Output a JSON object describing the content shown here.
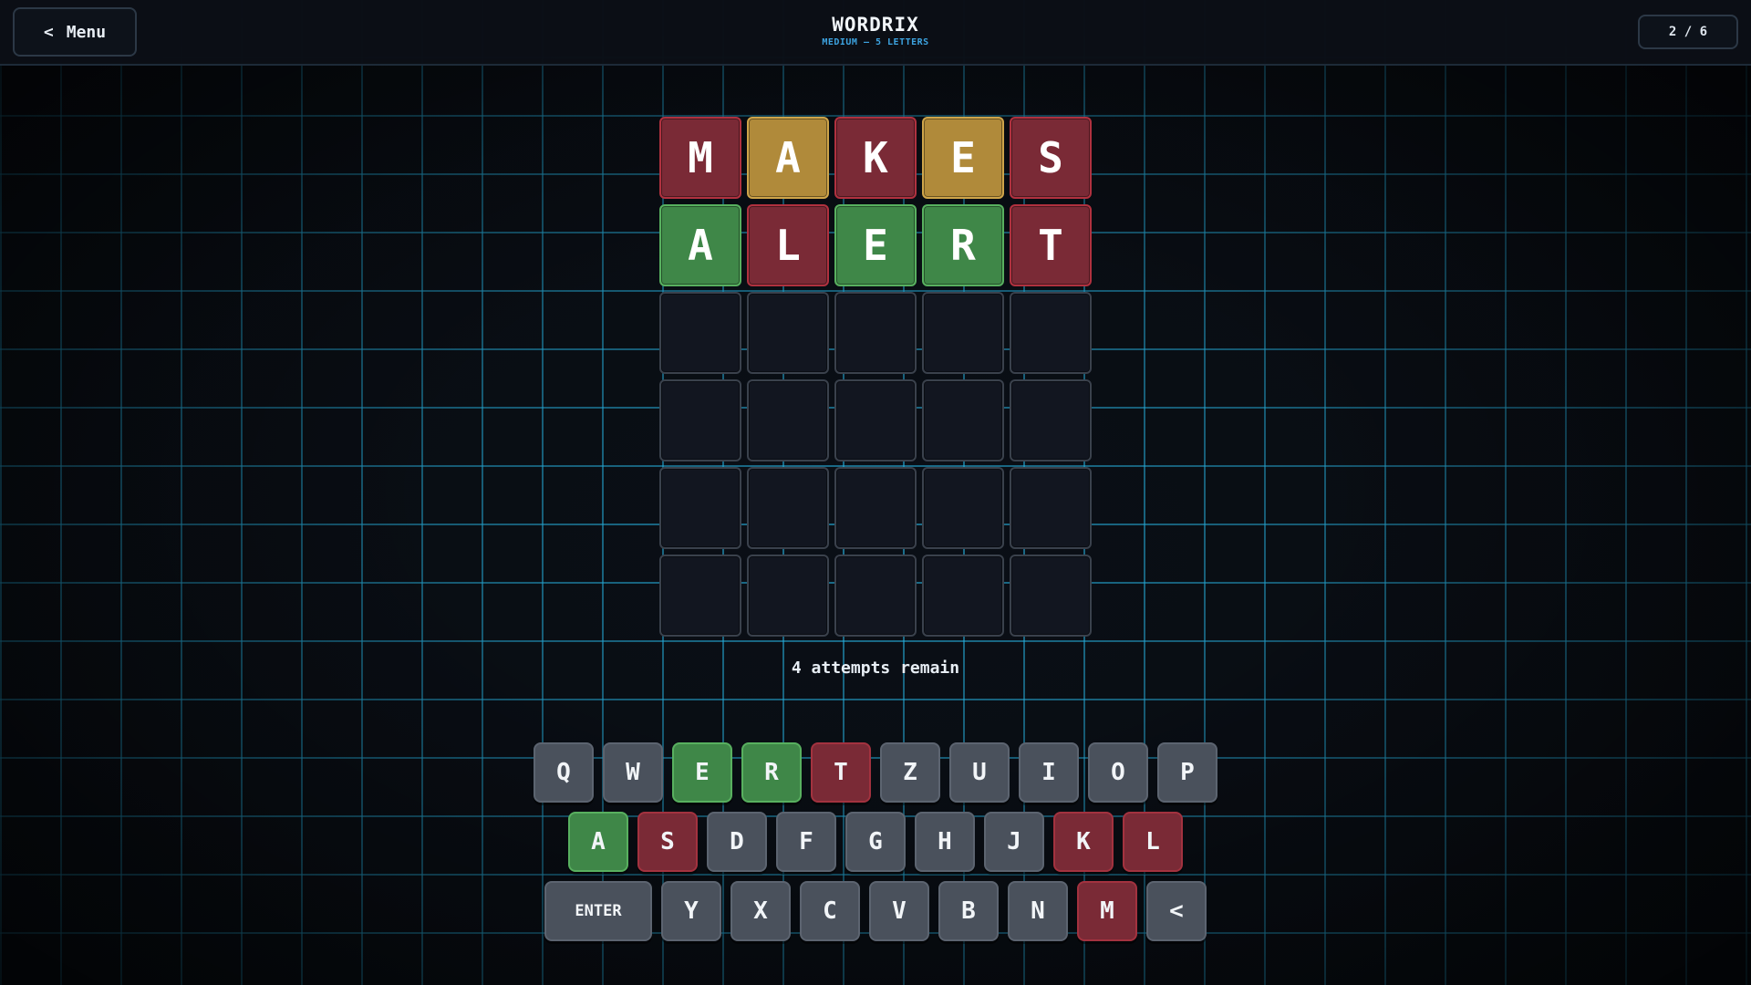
{
  "header": {
    "menu_chevron": "<",
    "menu_label": "Menu",
    "title": "WORDRIX",
    "subtitle": "MEDIUM – 5 LETTERS",
    "progress": "2 / 6"
  },
  "board": {
    "rows": [
      [
        {
          "letter": "M",
          "state": "absent"
        },
        {
          "letter": "A",
          "state": "present"
        },
        {
          "letter": "K",
          "state": "absent"
        },
        {
          "letter": "E",
          "state": "present"
        },
        {
          "letter": "S",
          "state": "absent"
        }
      ],
      [
        {
          "letter": "A",
          "state": "correct"
        },
        {
          "letter": "L",
          "state": "absent"
        },
        {
          "letter": "E",
          "state": "correct"
        },
        {
          "letter": "R",
          "state": "correct"
        },
        {
          "letter": "T",
          "state": "absent"
        }
      ],
      [
        {
          "letter": "",
          "state": "empty"
        },
        {
          "letter": "",
          "state": "empty"
        },
        {
          "letter": "",
          "state": "empty"
        },
        {
          "letter": "",
          "state": "empty"
        },
        {
          "letter": "",
          "state": "empty"
        }
      ],
      [
        {
          "letter": "",
          "state": "empty"
        },
        {
          "letter": "",
          "state": "empty"
        },
        {
          "letter": "",
          "state": "empty"
        },
        {
          "letter": "",
          "state": "empty"
        },
        {
          "letter": "",
          "state": "empty"
        }
      ],
      [
        {
          "letter": "",
          "state": "empty"
        },
        {
          "letter": "",
          "state": "empty"
        },
        {
          "letter": "",
          "state": "empty"
        },
        {
          "letter": "",
          "state": "empty"
        },
        {
          "letter": "",
          "state": "empty"
        }
      ],
      [
        {
          "letter": "",
          "state": "empty"
        },
        {
          "letter": "",
          "state": "empty"
        },
        {
          "letter": "",
          "state": "empty"
        },
        {
          "letter": "",
          "state": "empty"
        },
        {
          "letter": "",
          "state": "empty"
        }
      ]
    ]
  },
  "status": "4 attempts remain",
  "keyboard": {
    "rows": [
      [
        {
          "label": "Q",
          "state": "unused"
        },
        {
          "label": "W",
          "state": "unused"
        },
        {
          "label": "E",
          "state": "correct"
        },
        {
          "label": "R",
          "state": "correct"
        },
        {
          "label": "T",
          "state": "absent"
        },
        {
          "label": "Z",
          "state": "unused"
        },
        {
          "label": "U",
          "state": "unused"
        },
        {
          "label": "I",
          "state": "unused"
        },
        {
          "label": "O",
          "state": "unused"
        },
        {
          "label": "P",
          "state": "unused"
        }
      ],
      [
        {
          "label": "A",
          "state": "correct"
        },
        {
          "label": "S",
          "state": "absent"
        },
        {
          "label": "D",
          "state": "unused"
        },
        {
          "label": "F",
          "state": "unused"
        },
        {
          "label": "G",
          "state": "unused"
        },
        {
          "label": "H",
          "state": "unused"
        },
        {
          "label": "J",
          "state": "unused"
        },
        {
          "label": "K",
          "state": "absent"
        },
        {
          "label": "L",
          "state": "absent"
        }
      ],
      [
        {
          "label": "ENTER",
          "state": "unused",
          "wide": true
        },
        {
          "label": "Y",
          "state": "unused"
        },
        {
          "label": "X",
          "state": "unused"
        },
        {
          "label": "C",
          "state": "unused"
        },
        {
          "label": "V",
          "state": "unused"
        },
        {
          "label": "B",
          "state": "unused"
        },
        {
          "label": "N",
          "state": "unused"
        },
        {
          "label": "M",
          "state": "absent"
        },
        {
          "label": "<",
          "state": "unused",
          "name": "backspace"
        }
      ]
    ]
  },
  "colors": {
    "absent": "#7a2a36",
    "present": "#b08a3a",
    "correct": "#3f8748",
    "key_default": "#4a515c",
    "accent": "#3da3e0",
    "grid_glow": "#28bef0"
  }
}
